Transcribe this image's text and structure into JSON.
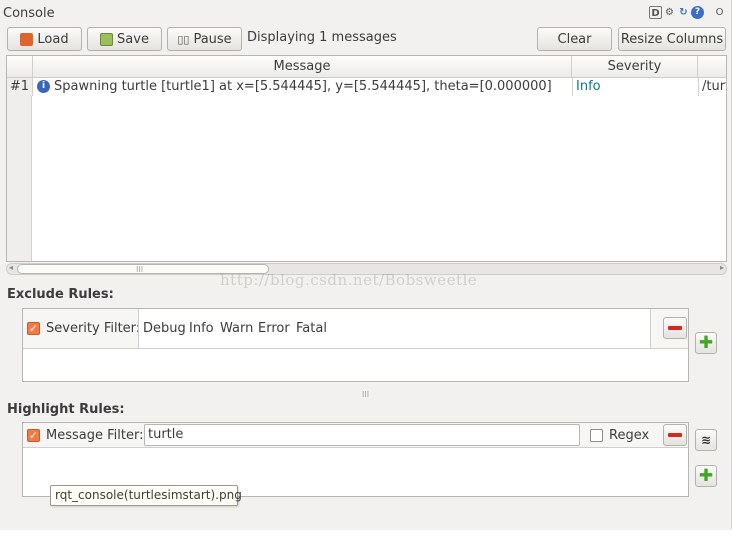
{
  "window": {
    "title": "Console",
    "side_label": "O"
  },
  "title_icons": [
    "D",
    "gear-icon",
    "refresh-icon",
    "?"
  ],
  "toolbar": {
    "load_label": "Load",
    "save_label": "Save",
    "pause_label": "Pause",
    "status_text": "Displaying 1 messages",
    "clear_label": "Clear",
    "resize_label": "Resize Columns"
  },
  "table": {
    "columns": [
      "Message",
      "Severity",
      ""
    ],
    "rows": [
      {
        "index": "#1",
        "icon": "info-icon",
        "message": "Spawning turtle [turtle1] at x=[5.544445], y=[5.544445], theta=[0.000000]",
        "severity": "Info",
        "node": "/turtl"
      }
    ]
  },
  "scroll": {
    "grip": "III"
  },
  "watermark": "http://blog.csdn.net/Bobsweetle",
  "exclude_rules": {
    "label": "Exclude Rules:",
    "filter_label": "Severity Filter:",
    "checked": true,
    "levels": [
      "Debug",
      "Info",
      "Warn",
      "Error",
      "Fatal"
    ]
  },
  "splitter_grip": "III",
  "highlight_rules": {
    "label": "Highlight Rules:",
    "filter_label": "Message Filter:",
    "checked": true,
    "filter_value": "turtle",
    "regex_label": "Regex",
    "regex_checked": false
  },
  "tooltip": "rqt_console(turtlesimstart).png",
  "colors": {
    "severity_info": "#0a7a8a",
    "accent_orange": "#f37a45",
    "remove_red": "#d7261e",
    "add_green": "#3fa626"
  }
}
